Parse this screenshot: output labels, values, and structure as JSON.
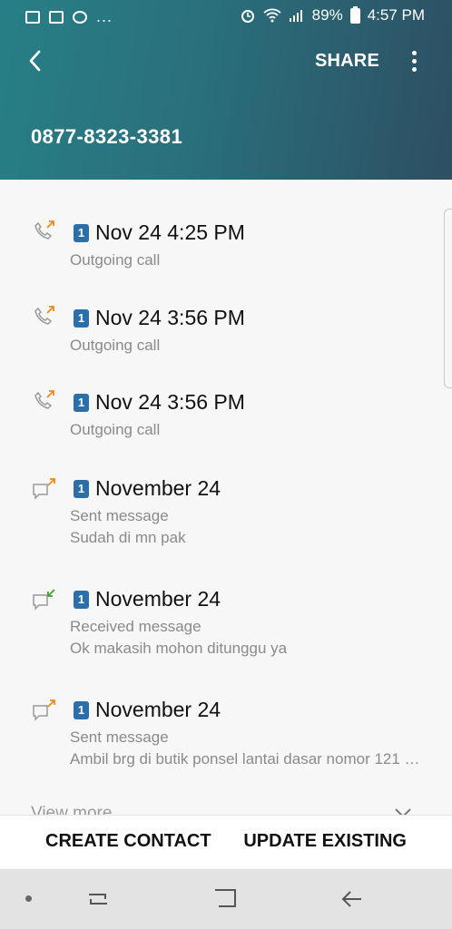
{
  "status_bar": {
    "battery_percent": "89%",
    "time": "4:57 PM",
    "notification_more": "..."
  },
  "toolbar": {
    "share_label": "SHARE"
  },
  "contact": {
    "number": "0877-8323-3381"
  },
  "history": [
    {
      "kind": "outgoing-call",
      "sim": "1",
      "title": "Nov 24 4:25 PM",
      "subtitle": "Outgoing call",
      "body": ""
    },
    {
      "kind": "outgoing-call",
      "sim": "1",
      "title": "Nov 24 3:56 PM",
      "subtitle": "Outgoing call",
      "body": ""
    },
    {
      "kind": "outgoing-call",
      "sim": "1",
      "title": "Nov 24 3:56 PM",
      "subtitle": "Outgoing call",
      "body": ""
    },
    {
      "kind": "sent-message",
      "sim": "1",
      "title": "November 24",
      "subtitle": "Sent message",
      "body": "Sudah di mn pak"
    },
    {
      "kind": "received-message",
      "sim": "1",
      "title": "November 24",
      "subtitle": "Received message",
      "body": "Ok makasih mohon ditunggu ya"
    },
    {
      "kind": "sent-message",
      "sim": "1",
      "title": "November 24",
      "subtitle": "Sent message",
      "body": "Ambil brg di butik ponsel lantai dasar nomor 121 …"
    }
  ],
  "view_more_label": "View more",
  "footer": {
    "create_label": "CREATE CONTACT",
    "update_label": "UPDATE EXISTING"
  },
  "colors": {
    "outgoing_arrow": "#f08a1e",
    "incoming_arrow": "#3ea43a",
    "sim_badge": "#2b6ea8"
  }
}
